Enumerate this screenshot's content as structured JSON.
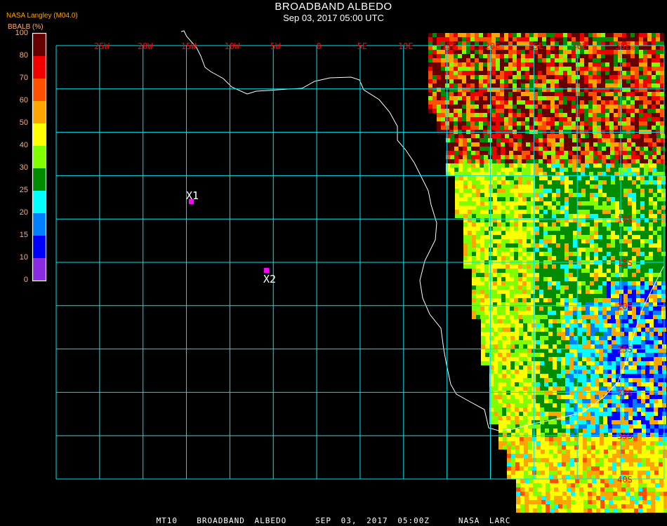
{
  "header": {
    "title": "BROADBAND ALBEDO",
    "subtitle": "Sep 03, 2017 05:00 UTC",
    "source": "NASA Langley (M04.0)"
  },
  "legend": {
    "unit_label": "BBALB (%)",
    "bins": [
      {
        "label": "100",
        "color": "#660000"
      },
      {
        "label": "80",
        "color": "#f20000"
      },
      {
        "label": "70",
        "color": "#ff5000"
      },
      {
        "label": "60",
        "color": "#ffa500"
      },
      {
        "label": "50",
        "color": "#ffff00"
      },
      {
        "label": "40",
        "color": "#80ff00"
      },
      {
        "label": "30",
        "color": "#008c00"
      },
      {
        "label": "25",
        "color": "#00ffff"
      },
      {
        "label": "20",
        "color": "#0080ff"
      },
      {
        "label": "15",
        "color": "#0000ff"
      },
      {
        "label": "10",
        "color": "#8a2be2"
      },
      {
        "label": "0",
        "color": null
      }
    ]
  },
  "map": {
    "grid_color": "#00e5ee",
    "label_color": "#ff0000",
    "coastline_color": "#ffffff",
    "longitude_labels": [
      "25W",
      "20W",
      "15W",
      "10W",
      "5W",
      "0",
      "5E",
      "10E",
      "15E",
      "20E",
      "25E",
      "30E",
      "35E"
    ],
    "latitude_labels": [
      "10S",
      "15S",
      "20S",
      "25S",
      "30S",
      "35S",
      "40S"
    ],
    "markers": [
      {
        "label": "X1",
        "color": "#ff00ff"
      },
      {
        "label": "X2",
        "color": "#ff00ff"
      }
    ]
  },
  "footer": {
    "text": "MT10  BROADBAND ALBEDO   SEP 03, 2017 05:00Z   NASA LARC"
  }
}
